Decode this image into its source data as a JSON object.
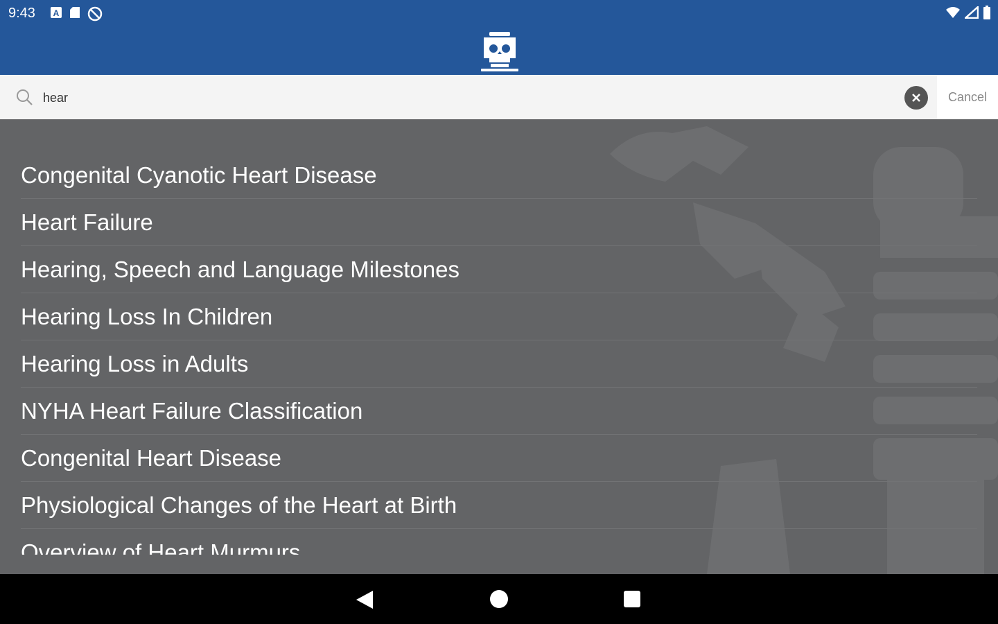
{
  "status_bar": {
    "time": "9:43",
    "left_icons": [
      "a-notification-icon",
      "sd-card-icon",
      "sync-off-icon"
    ],
    "right_icons": [
      "wifi-icon",
      "signal-icon",
      "battery-icon"
    ]
  },
  "app_bar": {
    "logo_icon": "skull-logo-icon",
    "color": "#24579a"
  },
  "search": {
    "query": "hear",
    "cancel_label": "Cancel"
  },
  "results": [
    {
      "title": "Congenital Cyanotic Heart Disease"
    },
    {
      "title": "Heart Failure"
    },
    {
      "title": "Hearing, Speech and Language Milestones"
    },
    {
      "title": "Hearing Loss In Children"
    },
    {
      "title": "Hearing Loss in Adults"
    },
    {
      "title": "NYHA Heart Failure Classification"
    },
    {
      "title": "Congenital Heart Disease"
    },
    {
      "title": "Physiological Changes of the Heart at Birth"
    },
    {
      "title": "Overview of Heart Murmurs"
    }
  ],
  "nav_bar": {
    "icons": [
      "back-icon",
      "home-icon",
      "recents-icon"
    ]
  }
}
